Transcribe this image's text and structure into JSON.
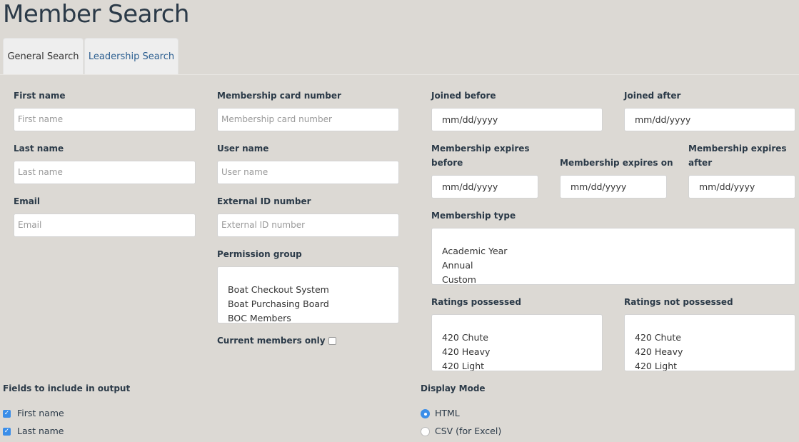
{
  "title": "Member Search",
  "tabs": [
    {
      "label": "General Search",
      "active": true
    },
    {
      "label": "Leadership Search",
      "active": false
    }
  ],
  "fields": {
    "first_name": {
      "label": "First name",
      "placeholder": "First name"
    },
    "last_name": {
      "label": "Last name",
      "placeholder": "Last name"
    },
    "email": {
      "label": "Email",
      "placeholder": "Email"
    },
    "card_number": {
      "label": "Membership card number",
      "placeholder": "Membership card number"
    },
    "user_name": {
      "label": "User name",
      "placeholder": "User name"
    },
    "external_id": {
      "label": "External ID number",
      "placeholder": "External ID number"
    },
    "permission_group": {
      "label": "Permission group",
      "options": [
        "Boat Checkout System",
        "Boat Purchasing Board",
        "BOC Members"
      ]
    },
    "current_members_only": {
      "label": "Current members only",
      "checked": false
    },
    "joined_before": {
      "label": "Joined before",
      "value": "mm/dd/yyyy"
    },
    "joined_after": {
      "label": "Joined after",
      "value": "mm/dd/yyyy"
    },
    "expires_before": {
      "label_1": "Membership expires",
      "label_2": "before",
      "value": "mm/dd/yyyy"
    },
    "expires_on": {
      "label": "Membership expires on",
      "value": "mm/dd/yyyy"
    },
    "expires_after": {
      "label_1": "Membership expires",
      "label_2": "after",
      "value": "mm/dd/yyyy"
    },
    "membership_type": {
      "label": "Membership type",
      "options": [
        "Academic Year",
        "Annual",
        "Custom"
      ]
    },
    "ratings_possessed": {
      "label": "Ratings possessed",
      "options": [
        "420 Chute",
        "420 Heavy",
        "420 Light"
      ]
    },
    "ratings_not_possessed": {
      "label": "Ratings not possessed",
      "options": [
        "420 Chute",
        "420 Heavy",
        "420 Light"
      ]
    }
  },
  "output": {
    "label": "Fields to include in output",
    "items": [
      {
        "label": "First name",
        "checked": true
      },
      {
        "label": "Last name",
        "checked": true
      }
    ]
  },
  "display_mode": {
    "label": "Display Mode",
    "options": [
      {
        "label": "HTML",
        "selected": true
      },
      {
        "label": "CSV (for Excel)",
        "selected": false
      }
    ]
  },
  "colors": {
    "accent": "#3b8ee8",
    "background": "#dcd9d4",
    "tab_link": "#2a5d8f"
  }
}
